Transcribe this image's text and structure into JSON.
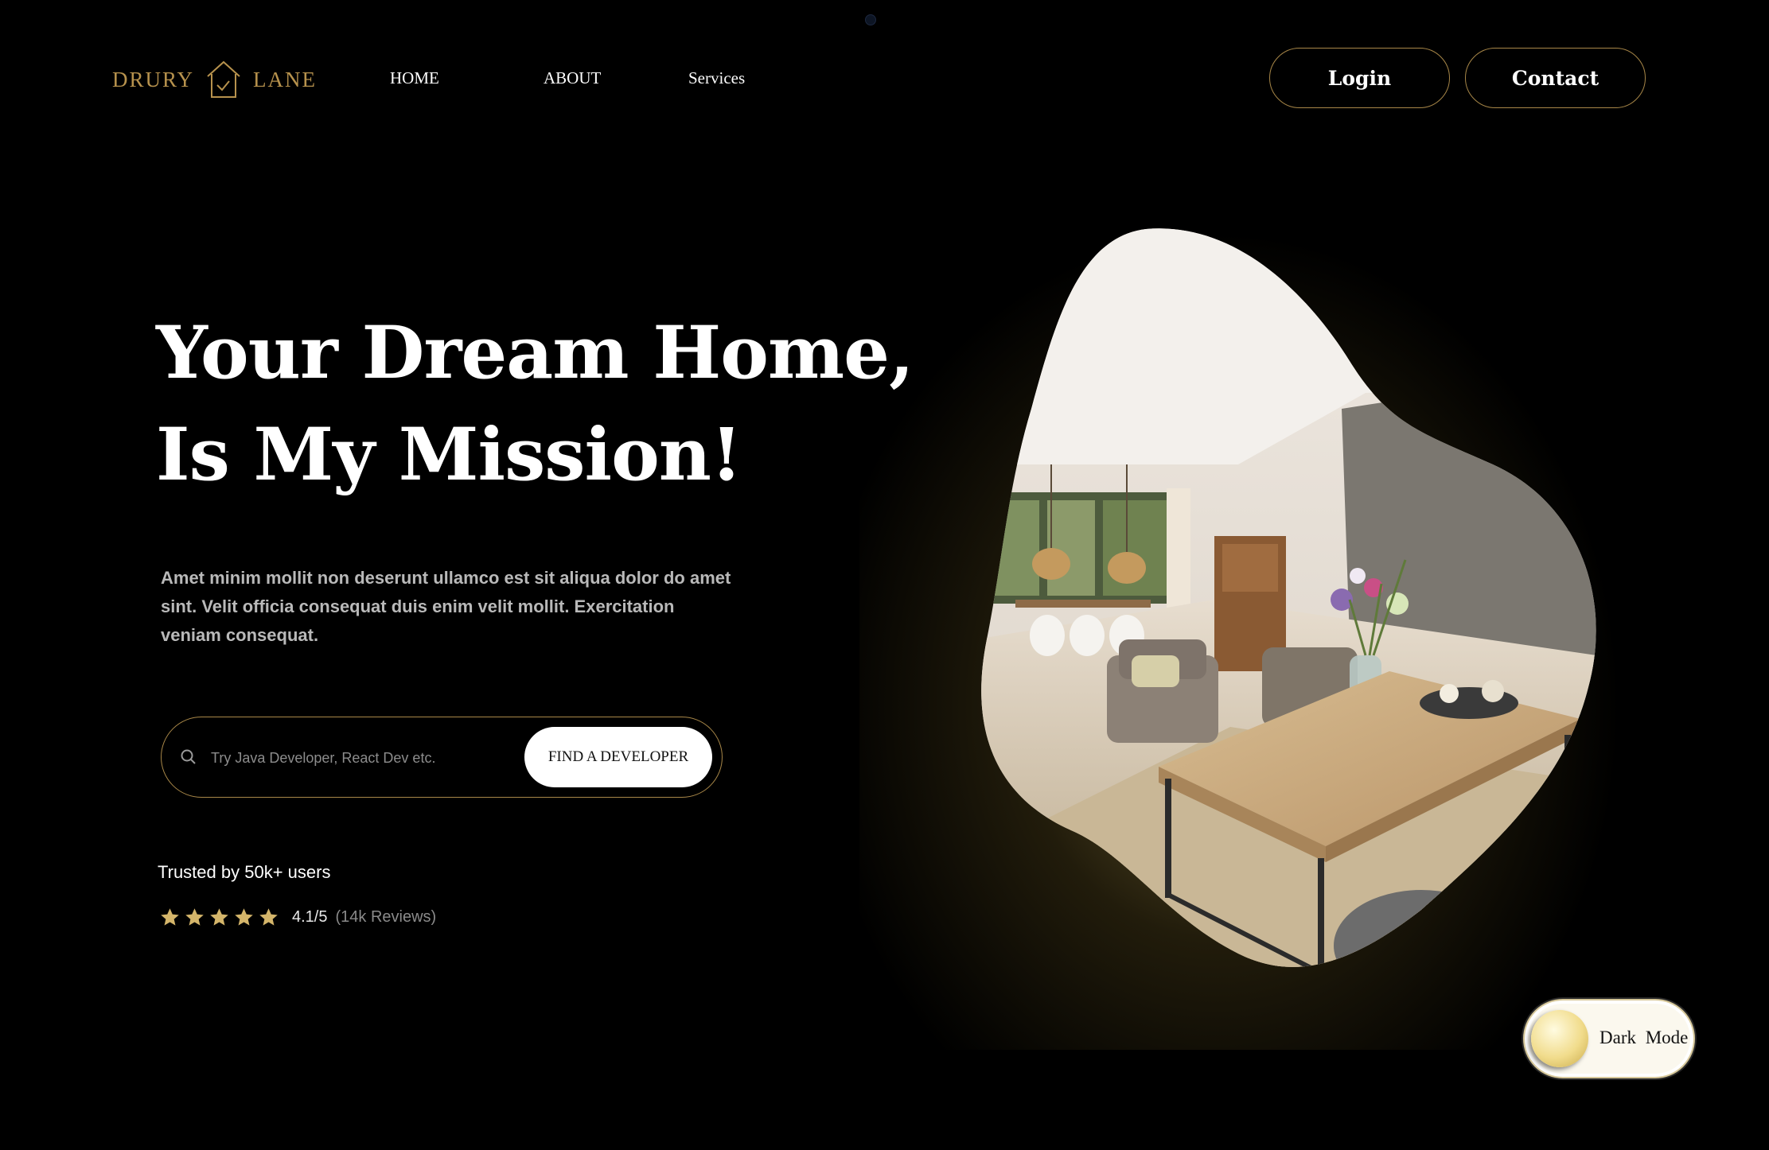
{
  "brand": {
    "word_left": "DRURY",
    "word_right": "LANE",
    "logo_icon": "house-check-icon",
    "accent_color": "#b7924d"
  },
  "nav": {
    "home": "HOME",
    "about": "ABOUT",
    "services": "Services"
  },
  "header_buttons": {
    "login": "Login",
    "contact": "Contact"
  },
  "hero": {
    "title_line1": "Your Dream Home,",
    "title_line2": "Is My Mission!",
    "description": "Amet minim mollit non deserunt ullamco est sit aliqua dolor do amet sint. Velit officia consequat duis enim velit mollit. Exercitation veniam consequat."
  },
  "search": {
    "placeholder": "Try Java Developer, React Dev etc.",
    "value": "",
    "button_label": "FIND A DEVELOPER",
    "icon": "search-icon"
  },
  "social_proof": {
    "trusted_text": "Trusted by 50k+ users",
    "stars": 5,
    "score": "4.1/5",
    "reviews": "(14k Reviews)",
    "star_color": "#d4b56a"
  },
  "hero_image": {
    "alt": "living-room-photo"
  },
  "theme_toggle": {
    "label": "Dark Mode"
  }
}
